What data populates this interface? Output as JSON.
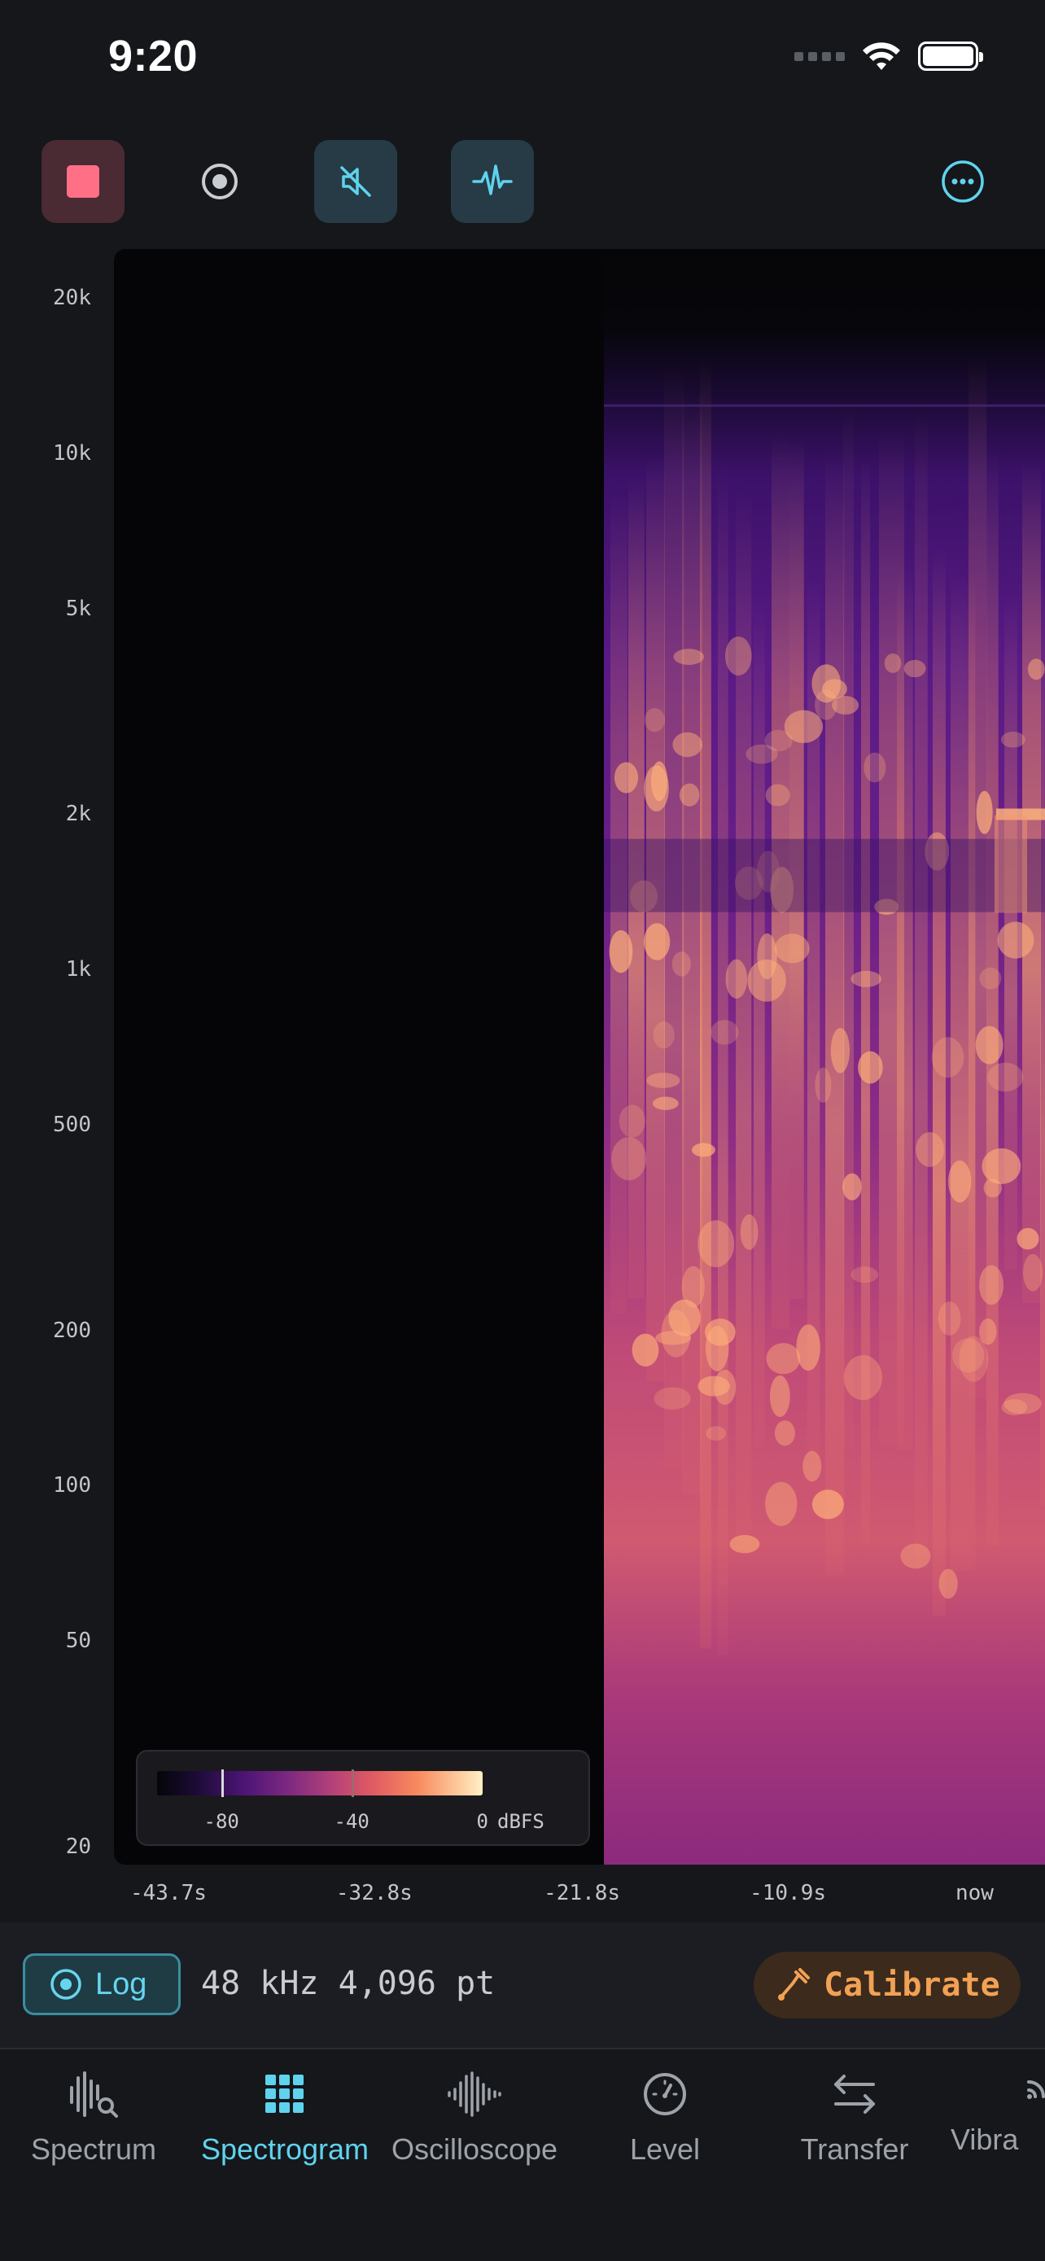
{
  "status": {
    "time": "9:20"
  },
  "colors": {
    "accent": "#5fd3ee",
    "stop": "#ff6f86",
    "calibrate": "#f2a155",
    "background": "#15171b"
  },
  "toolbar": {
    "buttons": [
      {
        "icon": "stop-icon",
        "active": true
      },
      {
        "icon": "record-icon",
        "active": false
      },
      {
        "icon": "speaker-muted-icon",
        "active": true
      },
      {
        "icon": "waveform-icon",
        "active": true
      },
      {
        "icon": "more-icon",
        "active": false
      }
    ]
  },
  "chart_data": {
    "type": "heatmap",
    "y_scale": "log",
    "y_ticks": [
      "20k",
      "10k",
      "5k",
      "2k",
      "1k",
      "500",
      "200",
      "100",
      "50",
      "20"
    ],
    "x_ticks": [
      "-43.7s",
      "-32.8s",
      "-21.8s",
      "-10.9s",
      "now"
    ],
    "ylim": [
      20,
      20000
    ],
    "xlim": [
      -43.7,
      0
    ],
    "signal_start": -26.0,
    "colorbar": {
      "labels": [
        "-80",
        "-40",
        "0"
      ],
      "unit": "dBFS",
      "range": [
        -100,
        0
      ],
      "markers": [
        -80,
        -40
      ]
    }
  },
  "info": {
    "log_label": "Log",
    "sample_rate": "48 kHz",
    "fft_size": "4,096 pt",
    "calibrate_label": "Calibrate"
  },
  "tabs": [
    {
      "label": "Spectrum",
      "icon": "spectrum-search-icon",
      "active": false
    },
    {
      "label": "Spectrogram",
      "icon": "grid-icon",
      "active": true
    },
    {
      "label": "Oscilloscope",
      "icon": "oscilloscope-wave-icon",
      "active": false
    },
    {
      "label": "Level",
      "icon": "gauge-icon",
      "active": false
    },
    {
      "label": "Transfer",
      "icon": "arrows-exchange-icon",
      "active": false
    },
    {
      "label": "Vibra",
      "icon": "vibration-icon",
      "active": false
    }
  ]
}
